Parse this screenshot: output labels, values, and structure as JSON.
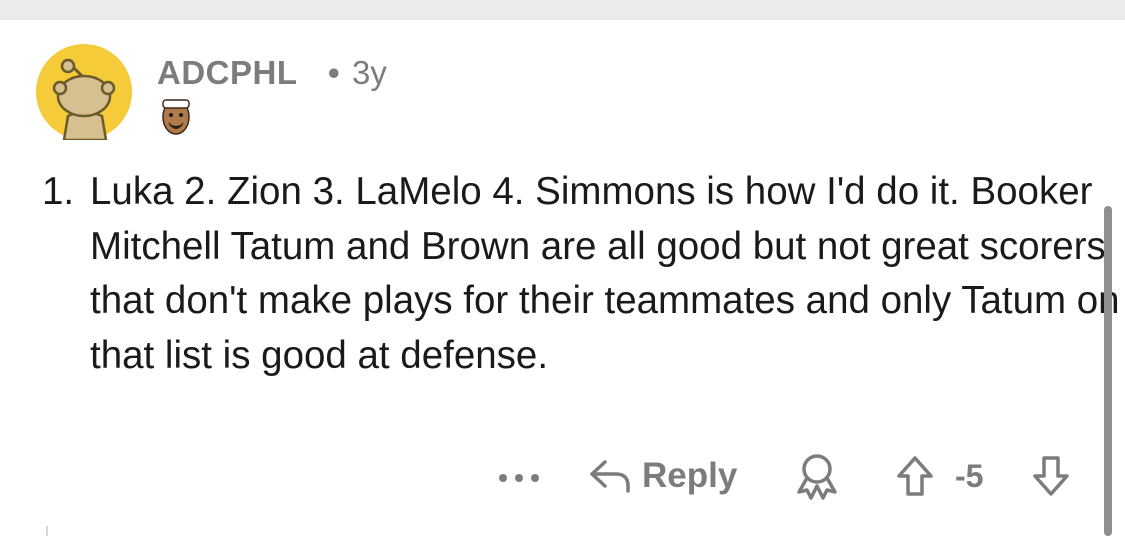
{
  "comment": {
    "author": "ADCPHL",
    "separator": "•",
    "age": "3y",
    "list_number": "1.",
    "body": "Luka 2. Zion 3. LaMelo 4. Simmons is how I'd do it. Booker Mitchell Tatum and Brown are all good but not great scorers that don't make plays for their teammates and only Tatum on that list is good at defense.",
    "avatar_icon": "snoo-avatar-icon",
    "flair_icon": "player-flair-icon"
  },
  "actions": {
    "more_icon": "more-dots-icon",
    "reply_label": "Reply",
    "reply_icon": "reply-arrow-icon",
    "award_icon": "award-icon",
    "upvote_icon": "upvote-arrow-icon",
    "score": "-5",
    "downvote_icon": "downvote-arrow-icon"
  },
  "colors": {
    "avatar_bg": "#f5cb3a",
    "meta_gray": "#7c7c7c",
    "text": "#1a1a1b",
    "top_strip": "#ebebed"
  }
}
